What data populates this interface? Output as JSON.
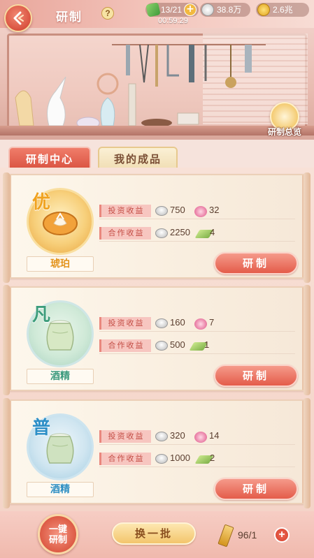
{
  "header": {
    "title": "研制",
    "help_label": "?"
  },
  "resources": {
    "stamina": "13/21",
    "silver": "38.8万",
    "gold": "2.6兆",
    "timer": "00:59:29"
  },
  "scene": {
    "overview_label": "研制总览"
  },
  "tabs": [
    {
      "label": "研制中心",
      "active": true
    },
    {
      "label": "我的成品",
      "active": false
    }
  ],
  "items": [
    {
      "grade": "优",
      "name": "琥珀",
      "invest_label": "投资收益",
      "coop_label": "合作收益",
      "invest_value": "750",
      "invest_bonus": "32",
      "coop_value": "2250",
      "coop_bonus": "4",
      "button_label": "研制"
    },
    {
      "grade": "凡",
      "name": "酒精",
      "invest_label": "投资收益",
      "coop_label": "合作收益",
      "invest_value": "160",
      "invest_bonus": "7",
      "coop_value": "500",
      "coop_bonus": "1",
      "button_label": "研制"
    },
    {
      "grade": "普",
      "name": "酒精",
      "invest_label": "投资收益",
      "coop_label": "合作收益",
      "invest_value": "320",
      "invest_bonus": "14",
      "coop_value": "1000",
      "coop_bonus": "2",
      "button_label": "研制"
    }
  ],
  "footer": {
    "onekey_line1": "一键",
    "onekey_line2": "研制",
    "refresh_label": "换一批",
    "count": "96/1",
    "add_label": "+"
  },
  "colors": {
    "accent": "#e45c4a",
    "grade_excellent": "#f0a21e",
    "grade_common": "#3d9d7b",
    "grade_normal": "#2d8fc7"
  }
}
